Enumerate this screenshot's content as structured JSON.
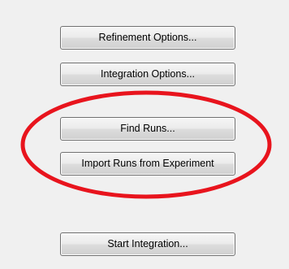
{
  "buttons": {
    "refinement_options": "Refinement Options...",
    "integration_options": "Integration Options...",
    "find_runs": "Find Runs...",
    "import_runs": "Import Runs from Experiment",
    "start_integration": "Start Integration..."
  },
  "highlight": {
    "shape": "ellipse",
    "color": "#e8141d",
    "encloses": [
      "find_runs",
      "import_runs"
    ]
  }
}
